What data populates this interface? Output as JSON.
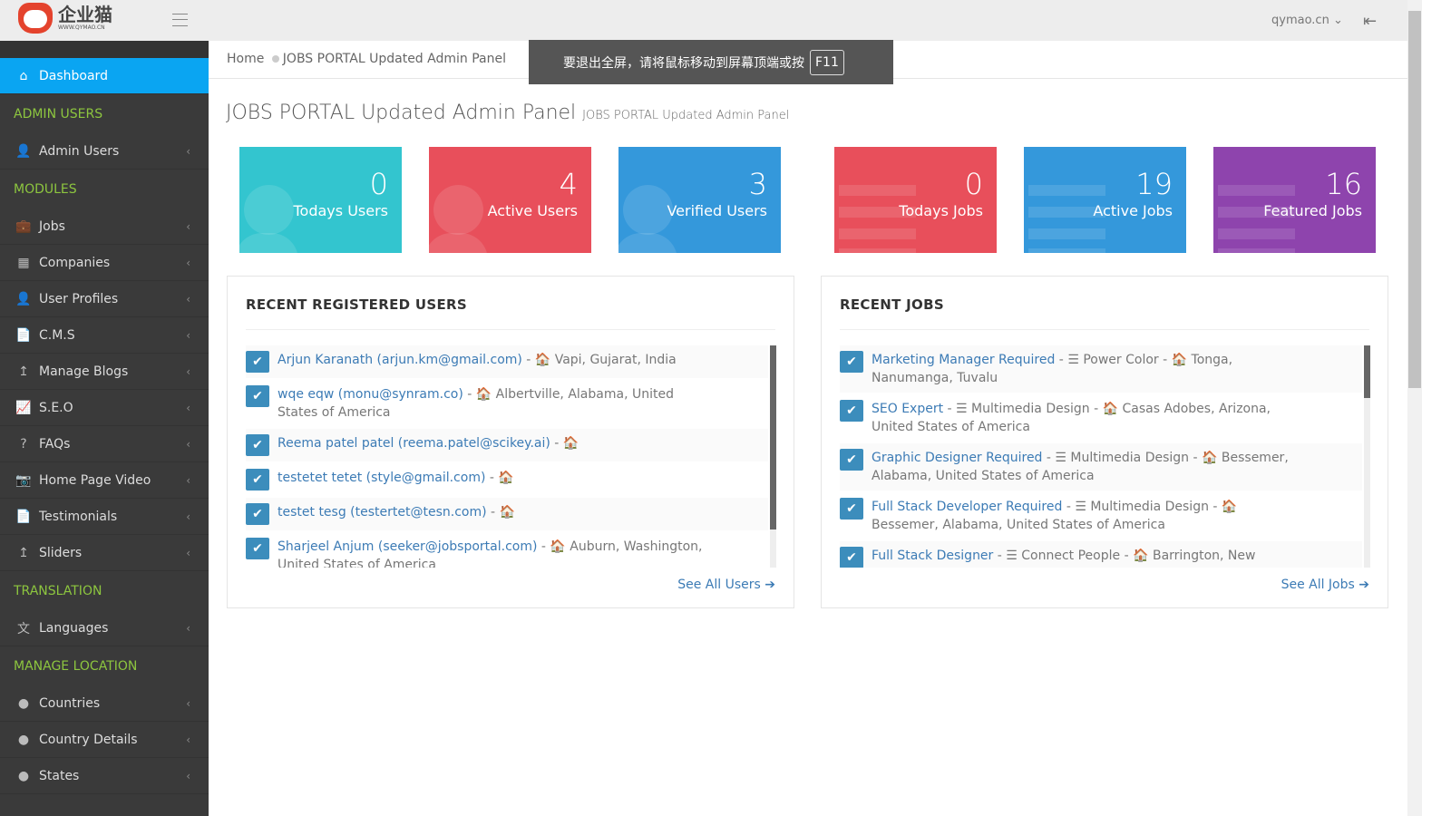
{
  "header": {
    "logo_text": "企业猫",
    "logo_sub": "WWW.QYMAO.CN",
    "user": "qymao.cn"
  },
  "sidebar": {
    "items": [
      {
        "type": "item",
        "label": "Dashboard",
        "icon": "⌂",
        "active": true
      },
      {
        "type": "head",
        "label": "ADMIN USERS"
      },
      {
        "type": "item",
        "label": "Admin Users",
        "icon": "👤"
      },
      {
        "type": "head",
        "label": "MODULES"
      },
      {
        "type": "item",
        "label": "Jobs",
        "icon": "💼"
      },
      {
        "type": "item",
        "label": "Companies",
        "icon": "▦"
      },
      {
        "type": "item",
        "label": "User Profiles",
        "icon": "👤"
      },
      {
        "type": "item",
        "label": "C.M.S",
        "icon": "📄"
      },
      {
        "type": "item",
        "label": "Manage Blogs",
        "icon": "↥"
      },
      {
        "type": "item",
        "label": "S.E.O",
        "icon": "📈"
      },
      {
        "type": "item",
        "label": "FAQs",
        "icon": "?"
      },
      {
        "type": "item",
        "label": "Home Page Video",
        "icon": "📷"
      },
      {
        "type": "item",
        "label": "Testimonials",
        "icon": "📄"
      },
      {
        "type": "item",
        "label": "Sliders",
        "icon": "↥"
      },
      {
        "type": "head",
        "label": "TRANSLATION"
      },
      {
        "type": "item",
        "label": "Languages",
        "icon": "文"
      },
      {
        "type": "head",
        "label": "MANAGE LOCATION"
      },
      {
        "type": "item",
        "label": "Countries",
        "icon": "●"
      },
      {
        "type": "item",
        "label": "Country Details",
        "icon": "●"
      },
      {
        "type": "item",
        "label": "States",
        "icon": "●"
      }
    ]
  },
  "breadcrumb": {
    "home": "Home",
    "current": "JOBS PORTAL Updated Admin Panel"
  },
  "toast": {
    "text": "要退出全屏，请将鼠标移动到屏幕顶端或按",
    "key": "F11"
  },
  "page": {
    "title": "JOBS PORTAL Updated Admin Panel",
    "subtitle": "JOBS PORTAL Updated Admin Panel"
  },
  "stats": [
    {
      "value": "0",
      "label": "Todays Users",
      "color": "#33c5cf",
      "kind": "user"
    },
    {
      "value": "4",
      "label": "Active Users",
      "color": "#e84f5b",
      "kind": "user"
    },
    {
      "value": "3",
      "label": "Verified Users",
      "color": "#3498db",
      "kind": "user"
    },
    {
      "value": "0",
      "label": "Todays Jobs",
      "color": "#e84f5b",
      "kind": "list"
    },
    {
      "value": "19",
      "label": "Active Jobs",
      "color": "#3498db",
      "kind": "list"
    },
    {
      "value": "16",
      "label": "Featured Jobs",
      "color": "#8e44ad",
      "kind": "list"
    }
  ],
  "users_panel": {
    "title": "RECENT REGISTERED USERS",
    "see_all": "See All Users",
    "items": [
      {
        "name": "Arjun Karanath (arjun.km@gmail.com)",
        "loc": "Vapi, Gujarat, India"
      },
      {
        "name": "wqe eqw (monu@synram.co)",
        "loc": "Albertville, Alabama, United States of America"
      },
      {
        "name": "Reema patel patel (reema.patel@scikey.ai)",
        "loc": ""
      },
      {
        "name": "testetet tetet (style@gmail.com)",
        "loc": ""
      },
      {
        "name": "testet tesg (testertet@tesn.com)",
        "loc": ""
      },
      {
        "name": "Sharjeel Anjum (seeker@jobsportal.com)",
        "loc": "Auburn, Washington, United States of America"
      }
    ]
  },
  "jobs_panel": {
    "title": "RECENT JOBS",
    "see_all": "See All Jobs",
    "items": [
      {
        "name": "Marketing Manager Required",
        "company": "Power Color",
        "loc": "Tonga, Nanumanga, Tuvalu"
      },
      {
        "name": "SEO Expert",
        "company": "Multimedia Design",
        "loc": "Casas Adobes, Arizona, United States of America"
      },
      {
        "name": "Graphic Designer Required",
        "company": "Multimedia Design",
        "loc": "Bessemer, Alabama, United States of America"
      },
      {
        "name": "Full Stack Developer Required",
        "company": "Multimedia Design",
        "loc": "Bessemer, Alabama, United States of America"
      },
      {
        "name": "Full Stack Designer",
        "company": "Connect People",
        "loc": "Barrington, New Hampshire,"
      }
    ]
  }
}
